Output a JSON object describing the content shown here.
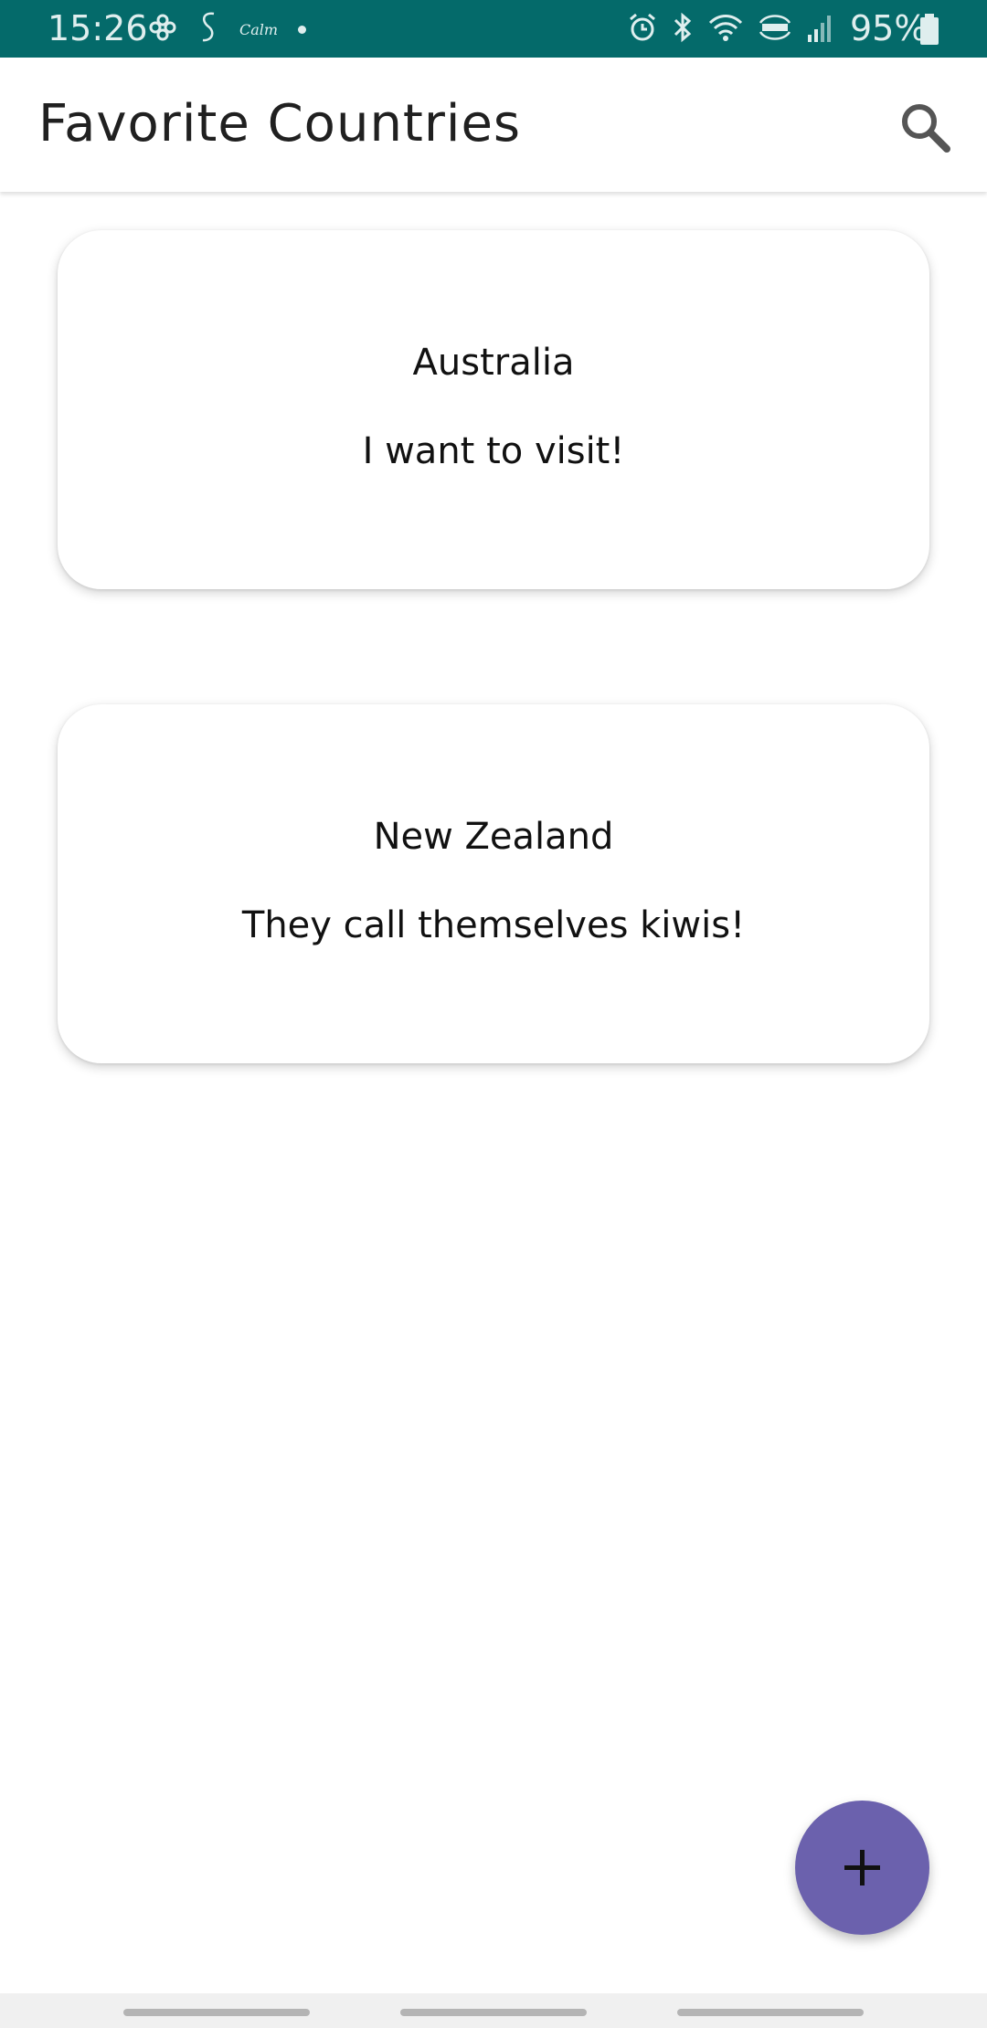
{
  "status_bar": {
    "time": "15:26",
    "calm_label": "Calm",
    "battery": "95%",
    "background": "#046a6a"
  },
  "app_bar": {
    "title": "Favorite Countries"
  },
  "cards": [
    {
      "title": "Australia",
      "note": "I want to visit!"
    },
    {
      "title": "New Zealand",
      "note": "They call themselves kiwis!"
    }
  ],
  "fab": {
    "icon": "plus-icon",
    "color": "#6b61ad"
  },
  "icons": {
    "search": "search-icon",
    "add": "plus-icon"
  }
}
